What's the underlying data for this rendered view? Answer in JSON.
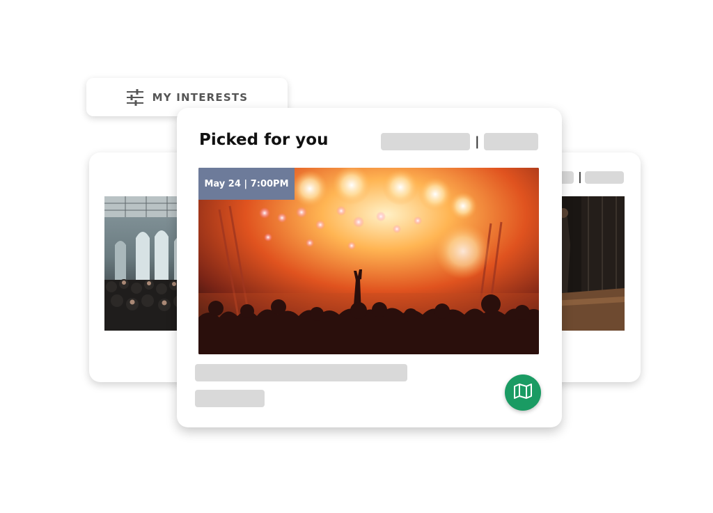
{
  "interests": {
    "label": "MY INTERESTS",
    "icon": "sliders-icon"
  },
  "main_card": {
    "title": "Picked for you",
    "separator": "|",
    "event_badge": "May 24 | 7:00PM",
    "hero_image": "concert-stage-crowd-photo",
    "map_button_icon": "map-icon"
  },
  "left_card": {
    "image": "indoor-venue-crowd-photo"
  },
  "right_card": {
    "separator": "|",
    "image": "dim-stage-performer-photo"
  },
  "colors": {
    "badge_bg": "#6d7b9a",
    "map_button": "#1a9b63",
    "placeholder": "#d9d9d9"
  }
}
